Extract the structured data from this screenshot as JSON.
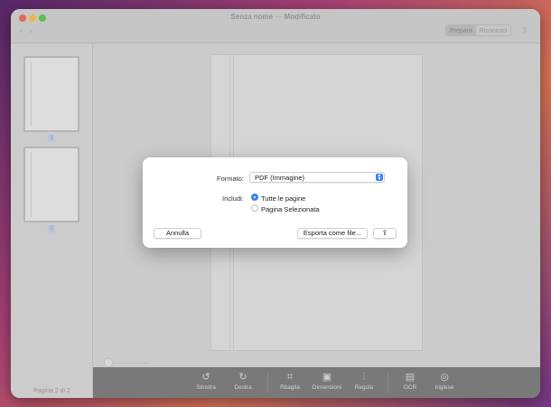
{
  "window": {
    "title": "Senza nome",
    "title_separator": "—",
    "title_status": "Modificato",
    "nav_back": "‹",
    "nav_forward": "›",
    "mode_tabs": [
      "Prepara",
      "Riconosci"
    ],
    "share_icon": "share-icon"
  },
  "sidebar": {
    "thumbnails": [
      {
        "label": "1"
      },
      {
        "label": "2"
      }
    ],
    "page_counter": "Pagina 2 di 2"
  },
  "toolbar": {
    "tools": [
      {
        "name": "rotate-left",
        "icon": "↺",
        "label": "Sinistra"
      },
      {
        "name": "rotate-right",
        "icon": "↻",
        "label": "Destra"
      },
      {
        "name": "crop",
        "icon": "⌗",
        "label": "Ritaglia"
      },
      {
        "name": "dimensions",
        "icon": "▣",
        "label": "Dimensioni"
      },
      {
        "name": "adjust",
        "icon": "⫶",
        "label": "Regola"
      },
      {
        "name": "ocr",
        "icon": "▤",
        "label": "OCR"
      },
      {
        "name": "language",
        "icon": "◎",
        "label": "Inglese"
      }
    ]
  },
  "dialog": {
    "format_label": "Formato:",
    "format_value": "PDF (Immagine)",
    "include_label": "Includi:",
    "options": [
      {
        "label": "Tutte le pagine",
        "selected": true
      },
      {
        "label": "Pagina Selezionata",
        "selected": false
      }
    ],
    "cancel_label": "Annulla",
    "export_label": "Esporta come file...",
    "share_glyph": "⇪"
  },
  "colors": {
    "accent": "#3a82f7",
    "traffic_red": "#ee6a5f",
    "traffic_yellow": "#f5bf4f",
    "traffic_green": "#61c554"
  }
}
